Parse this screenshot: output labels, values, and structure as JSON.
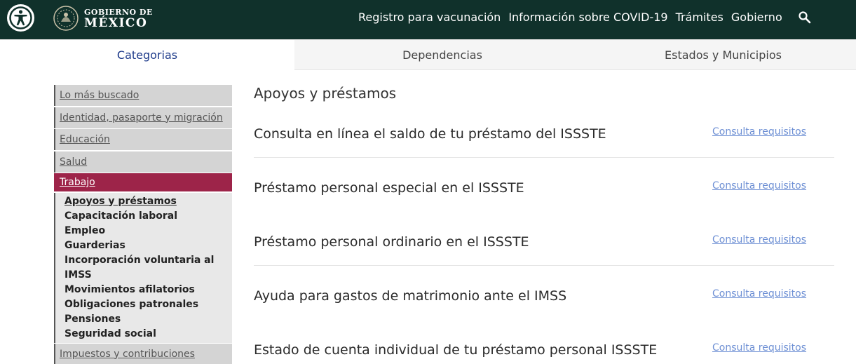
{
  "header": {
    "logo_top": "GOBIERNO DE",
    "logo_bottom": "MÉXICO",
    "nav": [
      {
        "label": "Registro para vacunación"
      },
      {
        "label": "Información sobre COVID-19"
      },
      {
        "label": "Trámites"
      },
      {
        "label": "Gobierno"
      }
    ],
    "search_icon": "search-icon",
    "accessibility_icon": "accessibility-icon",
    "colors": {
      "bar": "#10312b",
      "accent": "#9d2449"
    }
  },
  "tabs": [
    {
      "label": "Categorias",
      "active": true
    },
    {
      "label": "Dependencias",
      "active": false
    },
    {
      "label": "Estados y Municipios",
      "active": false
    }
  ],
  "sidebar": {
    "items_before": [
      {
        "label": "Lo más buscado"
      },
      {
        "label": "Identidad, pasaporte y migración"
      },
      {
        "label": "Educación"
      },
      {
        "label": "Salud"
      }
    ],
    "active": {
      "label": "Trabajo"
    },
    "subitems": [
      {
        "label": "Apoyos y préstamos"
      },
      {
        "label": "Capacitación laboral"
      },
      {
        "label": "Empleo"
      },
      {
        "label": "Guarderias"
      },
      {
        "label": "Incorporación voluntaria al"
      },
      {
        "label": "IMSS"
      },
      {
        "label": "Movimientos afilatorios"
      },
      {
        "label": "Obligaciones patronales"
      },
      {
        "label": "Pensiones"
      },
      {
        "label": "Seguridad social"
      }
    ],
    "items_after": [
      {
        "label": "Impuestos y contribuciones"
      }
    ]
  },
  "main": {
    "title": "Apoyos y préstamos",
    "rows": [
      {
        "title": "Consulta en línea el saldo de tu préstamo del ISSSTE",
        "link": "Consulta requisitos"
      },
      {
        "title": "Préstamo personal especial en el ISSSTE",
        "link": "Consulta requisitos"
      },
      {
        "title": "Préstamo personal ordinario en el ISSSTE",
        "link": "Consulta requisitos"
      },
      {
        "title": "Ayuda para gastos de matrimonio ante el IMSS",
        "link": "Consulta requisitos"
      },
      {
        "title": "Estado de cuenta individual de tu préstamo personal ISSSTE",
        "link": "Consulta requisitos"
      }
    ]
  }
}
